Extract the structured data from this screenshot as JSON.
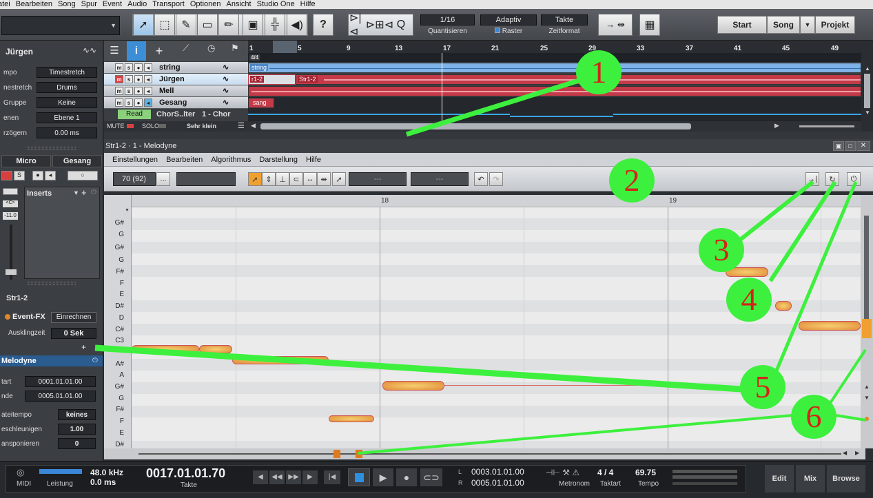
{
  "menubar": [
    "atei",
    "Bearbeiten",
    "Song",
    "Spur",
    "Event",
    "Audio",
    "Transport",
    "Optionen",
    "Ansicht",
    "Studio One",
    "Hilfe"
  ],
  "toolbar": {
    "help": "?",
    "q": "Q",
    "quantize_value": "1/16",
    "quantize_caption": "Quantisieren",
    "snap_value": "Adaptiv",
    "snap_caption": "Raster",
    "timebase_value": "Takte",
    "timebase_caption": "Zeitformat",
    "nav_start": "Start",
    "nav_song": "Song",
    "nav_project": "Projekt"
  },
  "inspector": {
    "track_name": "Jürgen",
    "rows": [
      {
        "label": "mpo",
        "value": "Timestretch"
      },
      {
        "label": "nestretch",
        "value": "Drums"
      },
      {
        "label": "Gruppe",
        "value": "Keine"
      },
      {
        "label": "enen",
        "value": "Ebene 1"
      },
      {
        "label": "rzögern",
        "value": "0.00 ms"
      }
    ],
    "tab_micro": "Micro",
    "tab_gesang": "Gesang",
    "inserts_label": "Inserts",
    "fader_value": "-11.0",
    "event_name": "Str1-2",
    "event_fx_label": "Event-FX",
    "render_button": "Einrechnen",
    "tail_label": "Ausklingzeit",
    "tail_value": "0 Sek",
    "plugin_name": "Melodyne",
    "start_label": "tart",
    "start_value": "0001.01.01.00",
    "end_label": "nde",
    "end_value": "0005.01.01.00",
    "tempo_label": "ateitempo",
    "tempo_value": "keines",
    "speed_label": "eschleunigen",
    "speed_value": "1.00",
    "transpose_label": "ansponieren",
    "transpose_value": "0"
  },
  "tracks": [
    {
      "name": "string",
      "selected": false
    },
    {
      "name": "Jürgen",
      "selected": true
    },
    {
      "name": "Mell",
      "selected": false
    },
    {
      "name": "Gesang",
      "selected": false
    }
  ],
  "automation": {
    "mode": "Read",
    "param": "ChorS..lter",
    "value": "1 - Chor"
  },
  "trackfooter": {
    "mute": "MUTE",
    "solo": "SOLO",
    "size": "Sehr klein"
  },
  "ruler": {
    "bars": [
      "1",
      "5",
      "9",
      "13",
      "17",
      "21",
      "25",
      "29",
      "33",
      "37",
      "41",
      "45",
      "49"
    ],
    "signature": "4/4"
  },
  "events": {
    "string": "string",
    "jurgen_1": "r1-2",
    "jurgen_2": "Str1-2",
    "gesang": "sang"
  },
  "melodyne": {
    "title": "Str1-2 · 1 - Melodyne",
    "menu": [
      "Einstellungen",
      "Bearbeiten",
      "Algorithmus",
      "Darstellung",
      "Hilfe"
    ],
    "tempo_field": "70 (92)",
    "field_dots": "...",
    "empty_1": "---",
    "empty_2": "---",
    "bar_markers": [
      "18",
      "19"
    ],
    "pitch_labels": [
      "G#",
      "G",
      "G#",
      "G",
      "F#",
      "F",
      "E",
      "D#",
      "D",
      "C#",
      "C3",
      "",
      "A#",
      "A",
      "G#",
      "G",
      "F#",
      "F",
      "E",
      "D#"
    ]
  },
  "transport": {
    "midi_label": "MIDI",
    "perf_label": "Leistung",
    "sample_rate": "48.0 kHz",
    "latency": "0.0 ms",
    "position": "0017.01.01.70",
    "position_caption": "Takte",
    "loop_l_label": "L",
    "loop_r_label": "R",
    "loop_start": "0003.01.01.00",
    "loop_end": "0005.01.01.00",
    "metronome_label": "Metronom",
    "time_sig": "4 / 4",
    "time_sig_caption": "Taktart",
    "tempo": "69.75",
    "tempo_caption": "Tempo",
    "btn_edit": "Edit",
    "btn_mix": "Mix",
    "btn_browse": "Browse"
  },
  "callouts": [
    "1",
    "2",
    "3",
    "4",
    "5",
    "6"
  ],
  "colors": {
    "callout_green": "#3df03d",
    "callout_text": "#d4231a",
    "event_red": "#c43a48",
    "event_blue": "#7fb2e6",
    "note_orange": "#e7903c"
  }
}
